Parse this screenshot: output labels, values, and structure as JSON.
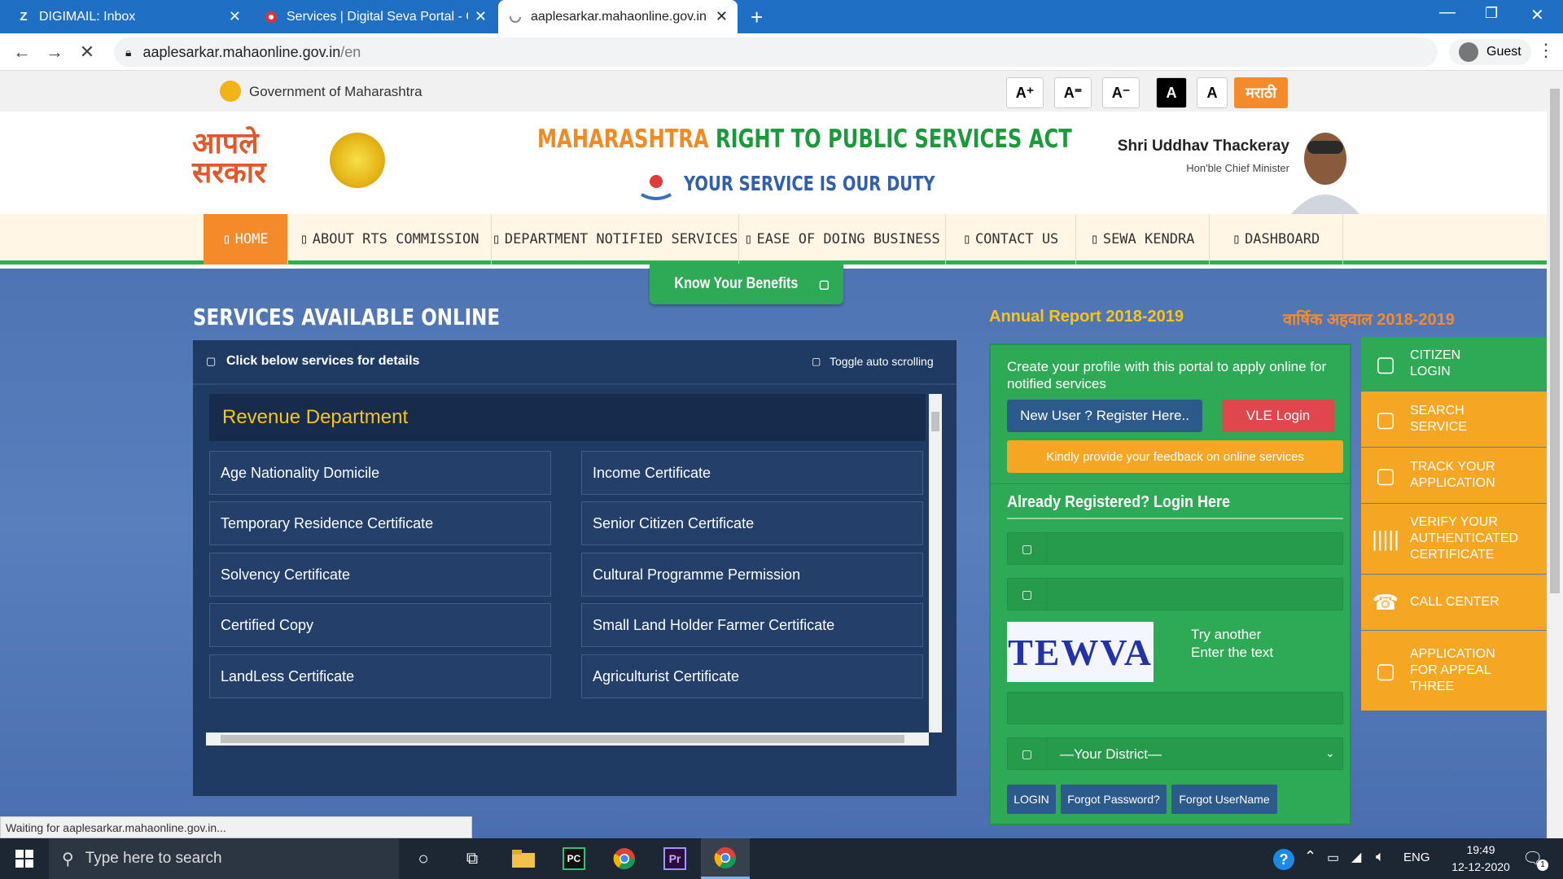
{
  "browser": {
    "tabs": [
      {
        "title": "DIGIMAIL: Inbox",
        "icon": "Z"
      },
      {
        "title": "Services | Digital Seva Portal - CS",
        "icon": "seva"
      },
      {
        "title": "aaplesarkar.mahaonline.gov.in",
        "icon": "loading"
      }
    ],
    "url_host": "aaplesarkar.mahaonline.gov.in",
    "url_path": "/en",
    "profile": "Guest",
    "status": "Waiting for aaplesarkar.mahaonline.gov.in..."
  },
  "govbar": {
    "label": "Government of Maharashtra",
    "font_buttons": [
      "A⁺",
      "A⁼",
      "A⁻"
    ],
    "contrast_dark": "A",
    "contrast_light": "A",
    "language": "मराठी"
  },
  "header": {
    "logo_text": "आपले सरकार",
    "act_title_orange": "MAHARASHTRA",
    "act_title_green": "RIGHT TO PUBLIC SERVICES ACT",
    "tagline": "YOUR SERVICE IS OUR DUTY",
    "cm_name": "Shri Uddhav Thackeray",
    "cm_title": "Hon'ble Chief Minister"
  },
  "menu": [
    "HOME",
    "ABOUT RTS COMMISSION",
    "DEPARTMENT NOTIFIED SERVICES",
    "EASE OF DOING BUSINESS",
    "CONTACT US",
    "SEWA KENDRA",
    "DASHBOARD"
  ],
  "benefits_label": "Know Your Benefits",
  "services": {
    "heading": "SERVICES AVAILABLE ONLINE",
    "click_label": "Click below services for details",
    "toggle_label": "Toggle auto scrolling",
    "department": "Revenue Department",
    "left": [
      "Age Nationality Domicile",
      "Temporary Residence Certificate",
      "Solvency Certificate",
      "Certified Copy",
      "LandLess Certificate"
    ],
    "right": [
      "Income Certificate",
      "Senior Citizen Certificate",
      "Cultural Programme Permission",
      "Small Land Holder Farmer Certificate",
      "Agriculturist Certificate"
    ]
  },
  "report": {
    "en": "Annual Report 2018-2019",
    "mr": "वार्षिक अहवाल 2018-2019"
  },
  "login": {
    "intro": "Create your profile with this portal to apply online for notified services",
    "register": "New User ? Register Here..",
    "vle": "VLE Login",
    "feedback": "Kindly provide your feedback on online services",
    "heading": "Already Registered? Login Here",
    "captcha": "TEWVA",
    "try_another": "Try another",
    "enter_text": "Enter the text",
    "district": "—Your District—",
    "login_btn": "LOGIN",
    "forgot_password": "Forgot Password?",
    "forgot_username": "Forgot UserName"
  },
  "side_buttons": [
    {
      "label": "CITIZEN LOGIN",
      "icon": "checkbox-icon",
      "color": "#2eaa56"
    },
    {
      "label": "SEARCH SERVICE",
      "icon": "checkbox-icon",
      "color": "#f5a623"
    },
    {
      "label": "TRACK YOUR APPLICATION",
      "icon": "checkbox-icon",
      "color": "#f5a623"
    },
    {
      "label": "VERIFY YOUR AUTHENTICATED CERTIFICATE",
      "icon": "barcode-icon",
      "color": "#f5a623"
    },
    {
      "label": "CALL CENTER",
      "icon": "phone-icon",
      "color": "#f5a623"
    },
    {
      "label": "APPLICATION FOR APPEAL THREE",
      "icon": "checkbox-icon",
      "color": "#f5a623"
    }
  ],
  "taskbar": {
    "search_placeholder": "Type here to search",
    "lang": "ENG",
    "time": "19:49",
    "date": "12-12-2020",
    "notifications": "1"
  }
}
